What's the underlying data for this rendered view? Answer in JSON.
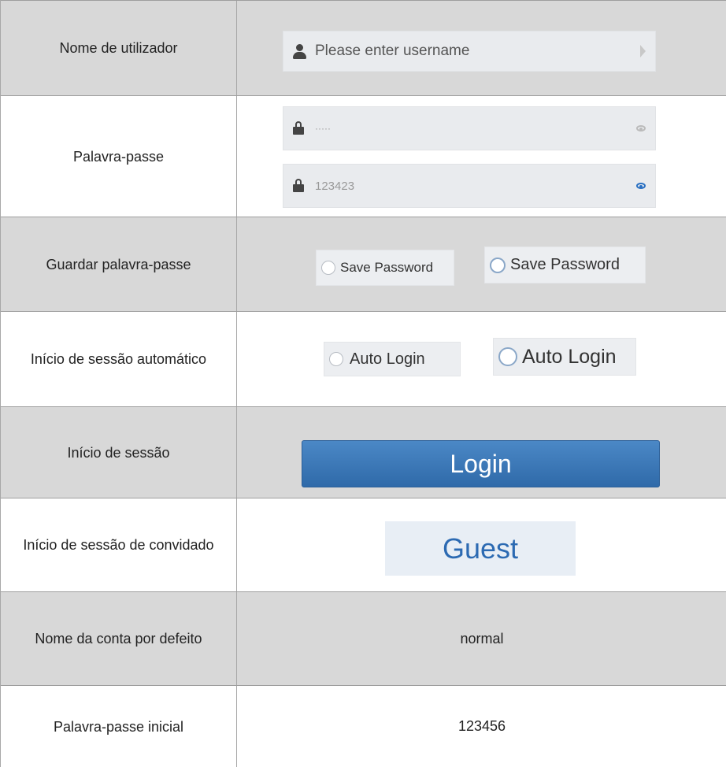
{
  "rows": [
    {
      "label": "Nome de utilizador"
    },
    {
      "label": "Palavra-passe"
    },
    {
      "label": "Guardar palavra-passe"
    },
    {
      "label": "Início de sessão automático"
    },
    {
      "label": "Início de sessão"
    },
    {
      "label": "Início de sessão de convidado"
    },
    {
      "label": "Nome da conta por defeito"
    },
    {
      "label": "Palavra-passe inicial"
    }
  ],
  "username_field": {
    "placeholder": "Please enter username",
    "icon": "user-icon"
  },
  "password_fields": [
    {
      "value": "·····",
      "icon": "lock-icon",
      "eye": "eye-icon"
    },
    {
      "value": "123423",
      "icon": "lock-icon",
      "eye": "eye-icon"
    }
  ],
  "save_password": {
    "unchecked_label": "Save Password",
    "checked_label": "Save Password"
  },
  "auto_login": {
    "unchecked_label": "Auto Login",
    "checked_label": "Auto Login"
  },
  "login_button": {
    "label": "Login"
  },
  "guest_button": {
    "label": "Guest"
  },
  "default_account": {
    "value": "normal"
  },
  "initial_password": {
    "value": "123456"
  },
  "colors": {
    "gray_row": "#d8d8d8",
    "accent_blue": "#2f6aa9",
    "guest_text": "#2c6ab2"
  }
}
